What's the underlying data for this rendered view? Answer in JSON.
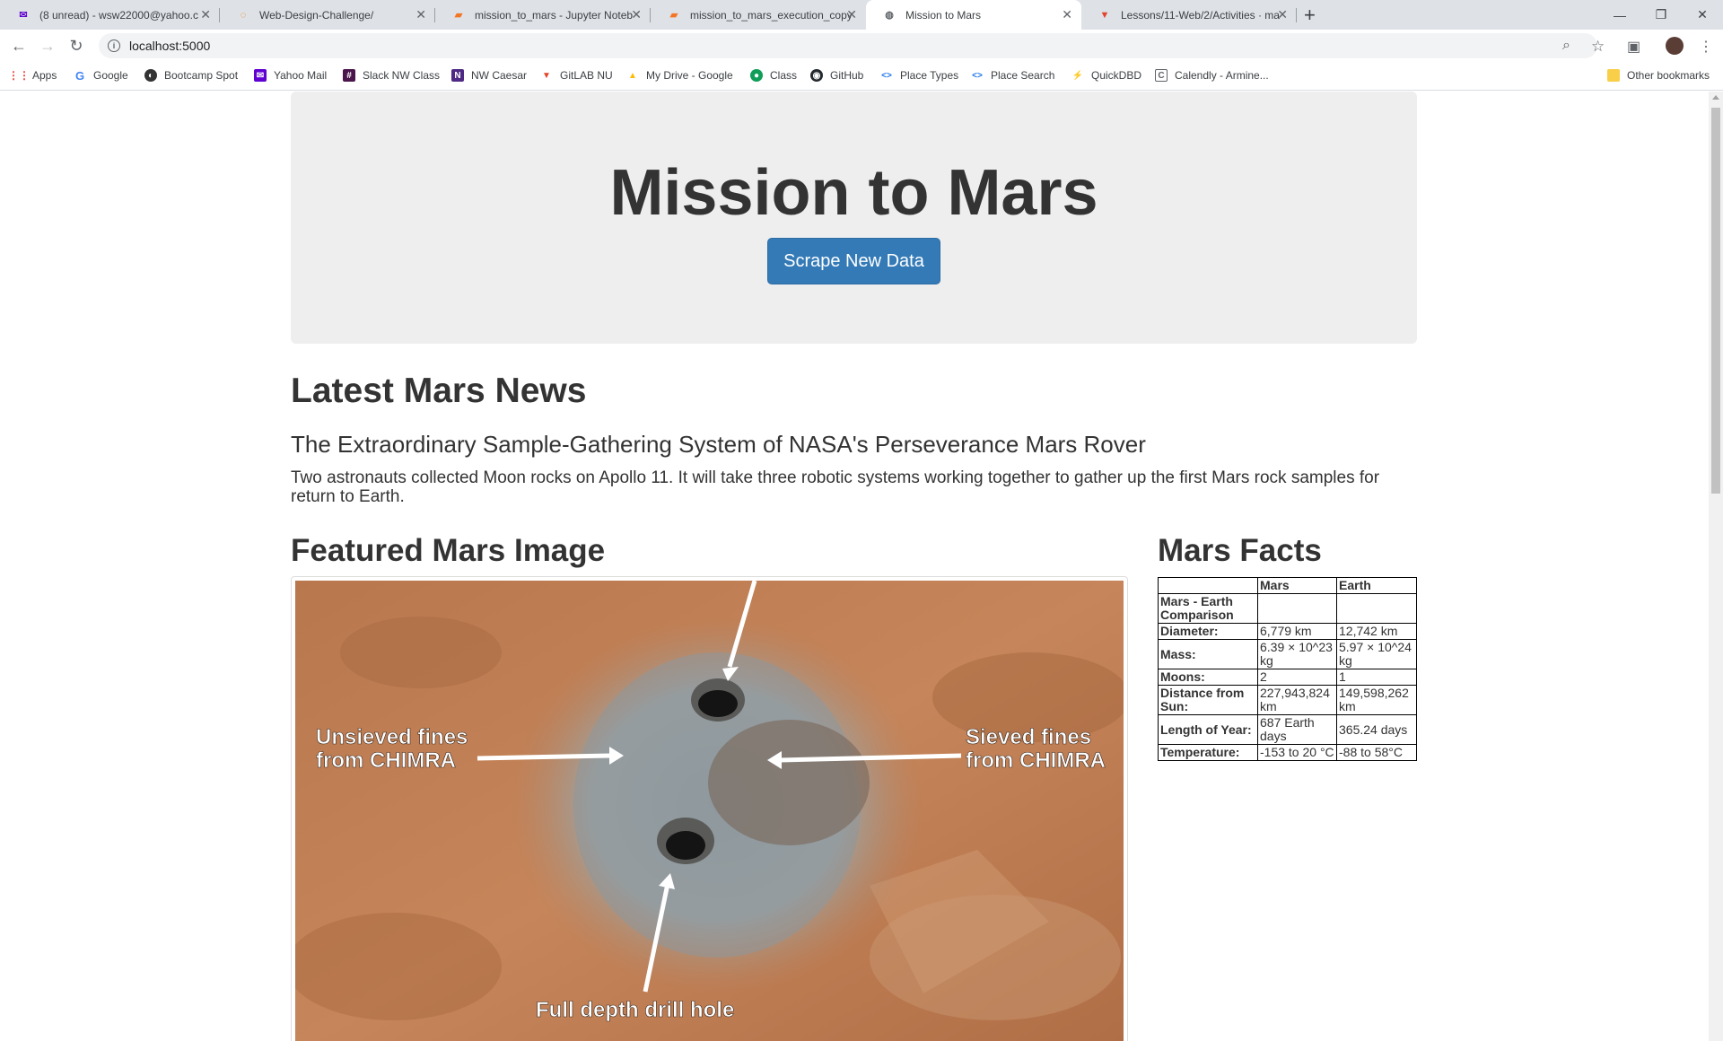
{
  "browser": {
    "tabs": [
      {
        "label": "(8 unread) - wsw22000@yahoo.c",
        "icon": "mail-icon",
        "color": "#6001d2"
      },
      {
        "label": "Web-Design-Challenge/",
        "icon": "loading-icon",
        "color": "#f57c00"
      },
      {
        "label": "mission_to_mars - Jupyter Noteb",
        "icon": "jupyter-icon",
        "color": "#f37626"
      },
      {
        "label": "mission_to_mars_execution_copy",
        "icon": "jupyter-icon",
        "color": "#f37626"
      },
      {
        "label": "Mission to Mars",
        "icon": "globe-icon",
        "color": "#5f6368"
      },
      {
        "label": "Lessons/11-Web/2/Activities · ma",
        "icon": "gitlab-icon",
        "color": "#e24329"
      }
    ],
    "new_tab": "+",
    "address": "localhost:5000",
    "bookmarks": [
      {
        "label": "Apps",
        "icon": "apps-grid-icon"
      },
      {
        "label": "Google",
        "icon": "google-icon"
      },
      {
        "label": "Bootcamp Spot",
        "icon": "bootcamp-icon"
      },
      {
        "label": "Yahoo Mail",
        "icon": "yahoo-mail-icon"
      },
      {
        "label": "Slack NW Class",
        "icon": "slack-icon"
      },
      {
        "label": "NW Caesar",
        "icon": "northwestern-icon"
      },
      {
        "label": "GitLAB NU",
        "icon": "gitlab-icon"
      },
      {
        "label": "My Drive - Google",
        "icon": "drive-icon"
      },
      {
        "label": "Class",
        "icon": "class-icon"
      },
      {
        "label": "GitHub",
        "icon": "github-icon"
      },
      {
        "label": "Place Types",
        "icon": "code-icon"
      },
      {
        "label": "Place Search",
        "icon": "code-icon"
      },
      {
        "label": "QuickDBD",
        "icon": "quickdbd-icon"
      },
      {
        "label": "Calendly - Armine...",
        "icon": "calendly-icon"
      }
    ],
    "other_bookmarks": "Other bookmarks"
  },
  "page": {
    "title": "Mission to Mars",
    "scrape_button": "Scrape New Data",
    "news_heading": "Latest Mars News",
    "news_title": "The Extraordinary Sample-Gathering System of NASA's Perseverance Mars Rover",
    "news_paragraph": "Two astronauts collected Moon rocks on Apollo 11. It will take three robotic systems working together to gather up the first Mars rock samples for return to Earth.",
    "featured_heading": "Featured Mars Image",
    "featured_image": {
      "labels": [
        "Unsieved fines from CHIMRA",
        "Sieved fines from CHIMRA",
        "Full depth drill hole"
      ]
    },
    "facts_heading": "Mars Facts",
    "facts_table": {
      "headers": [
        "",
        "Mars",
        "Earth"
      ],
      "rows": [
        [
          "Mars - Earth Comparison",
          "",
          ""
        ],
        [
          "Diameter:",
          "6,779 km",
          "12,742 km"
        ],
        [
          "Mass:",
          "6.39 × 10^23 kg",
          "5.97 × 10^24 kg"
        ],
        [
          "Moons:",
          "2",
          "1"
        ],
        [
          "Distance from Sun:",
          "227,943,824 km",
          "149,598,262 km"
        ],
        [
          "Length of Year:",
          "687 Earth days",
          "365.24 days"
        ],
        [
          "Temperature:",
          "-153 to 20 °C",
          "-88 to 58°C"
        ]
      ]
    }
  },
  "colors": {
    "primary_button": "#337ab7",
    "jumbotron": "#eeeeee"
  }
}
